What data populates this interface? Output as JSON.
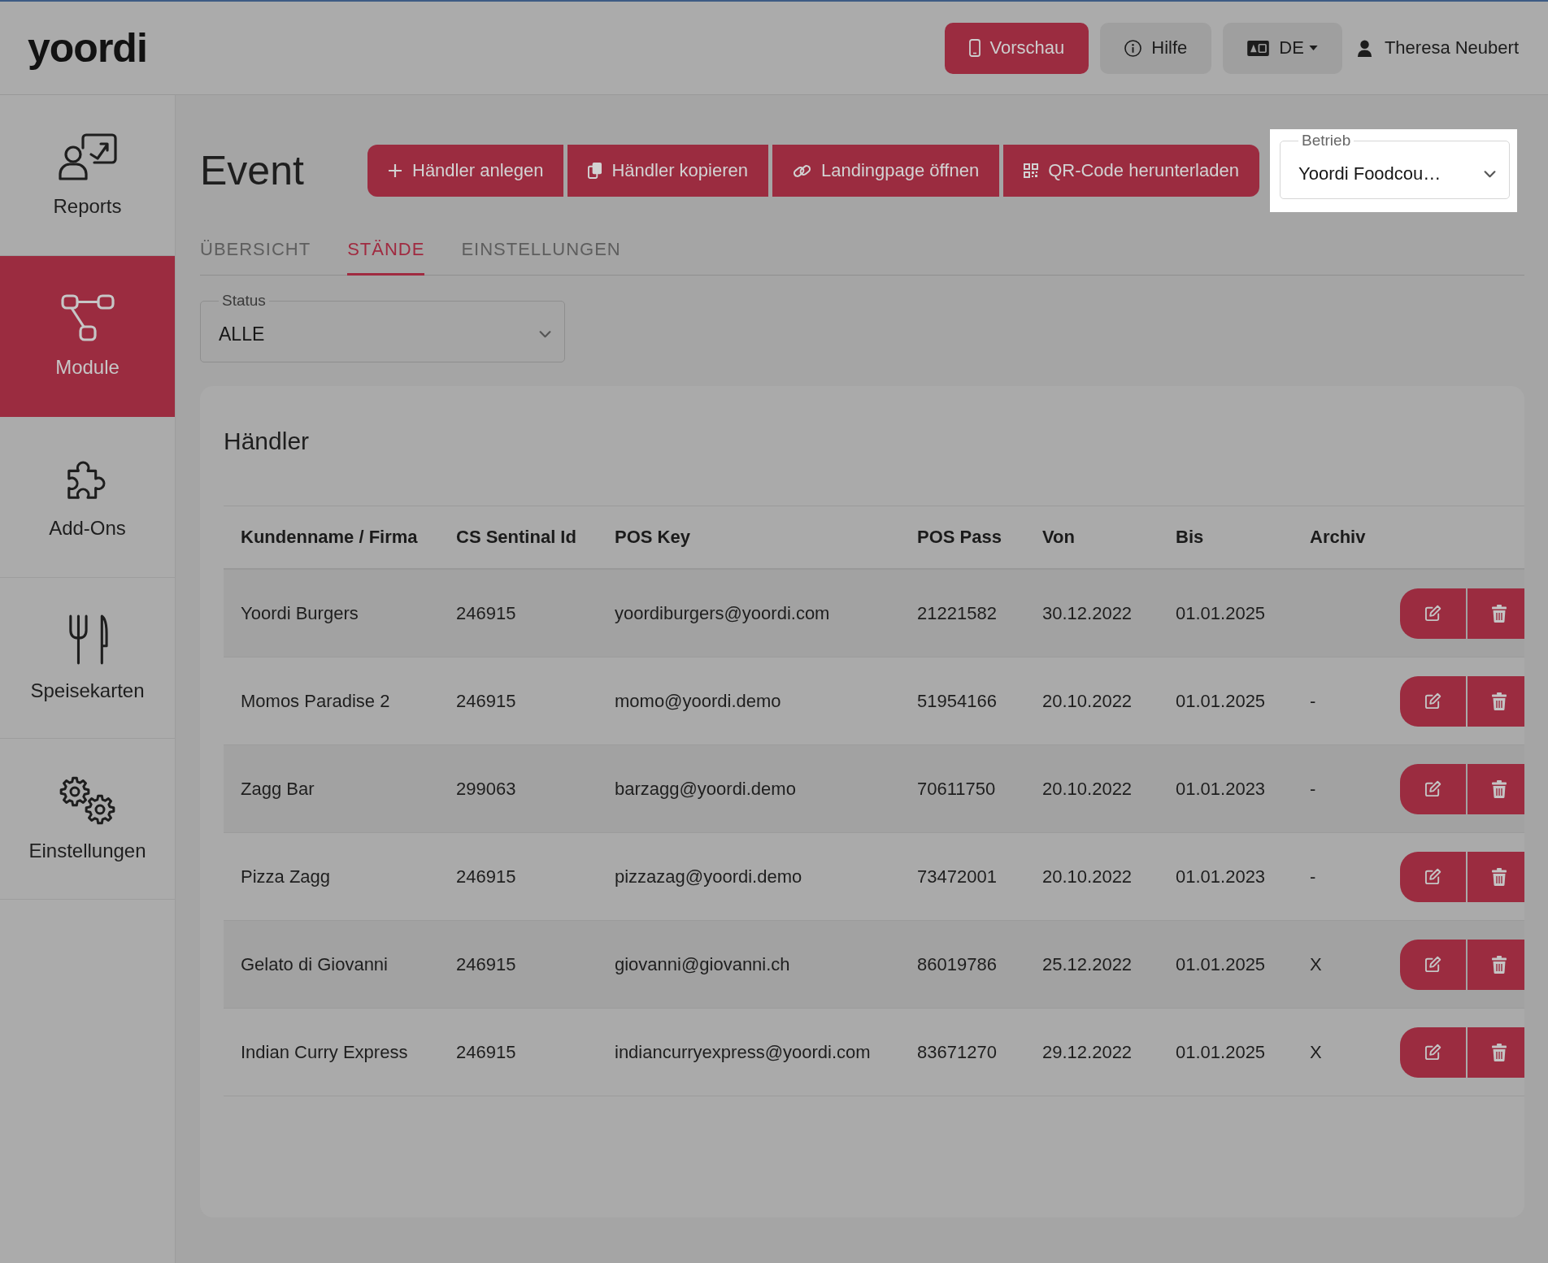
{
  "header": {
    "logo": "yoordi",
    "buttons": [
      {
        "kind": "preview",
        "label": "Vorschau"
      },
      {
        "kind": "help",
        "label": "Hilfe"
      },
      {
        "kind": "language",
        "label": "DE"
      }
    ],
    "user": {
      "name": "Theresa Neubert"
    }
  },
  "sidebar": {
    "items": [
      {
        "kind": "reports",
        "label": "Reports",
        "selected": false
      },
      {
        "kind": "modules",
        "label": "Module",
        "selected": true
      },
      {
        "kind": "addons",
        "label": "Add-Ons",
        "selected": false
      },
      {
        "kind": "menus",
        "label": "Speisekarten",
        "selected": false
      },
      {
        "kind": "settings",
        "label": "Einstellungen",
        "selected": false
      }
    ]
  },
  "page": {
    "title": "Event",
    "actions": [
      {
        "kind": "add",
        "label": "Händler anlegen"
      },
      {
        "kind": "copy",
        "label": "Händler kopieren"
      },
      {
        "kind": "link",
        "label": "Landingpage öffnen"
      },
      {
        "kind": "qr",
        "label": "QR-Code herunterladen"
      }
    ],
    "business_select": {
      "label": "Betrieb",
      "value": "Yoordi Foodcou…",
      "highlighted": true
    }
  },
  "tabs": [
    {
      "label": "ÜBERSICHT",
      "selected": false
    },
    {
      "label": "STÄNDE",
      "selected": true
    },
    {
      "label": "EINSTELLUNGEN",
      "selected": false
    }
  ],
  "status_filter": {
    "label": "Status",
    "value": "ALLE"
  },
  "merchants": {
    "title": "Händler",
    "columns": [
      "Kundenname / Firma",
      "CS Sentinal Id",
      "POS Key",
      "POS Pass",
      "Von",
      "Bis",
      "Archiv"
    ],
    "rows": [
      {
        "cells": [
          "Yoordi Burgers",
          "246915",
          "yoordiburgers@yoordi.com",
          "21221582",
          "30.12.2022",
          "01.01.2025"
        ]
      },
      {
        "cells": [
          "Momos Paradise 2",
          "246915",
          "momo@yoordi.demo",
          "51954166",
          "20.10.2022",
          "01.01.2025",
          "-"
        ]
      },
      {
        "cells": [
          "Zagg Bar",
          "299063",
          "barzagg@yoordi.demo",
          "70611750",
          "20.10.2022",
          "01.01.2023",
          "-"
        ]
      },
      {
        "cells": [
          "Pizza Zagg",
          "246915",
          "pizzazag@yoordi.demo",
          "73472001",
          "20.10.2022",
          "01.01.2023",
          "-"
        ]
      },
      {
        "cells": [
          "Gelato di Giovanni",
          "246915",
          "giovanni@giovanni.ch",
          "86019786",
          "25.12.2022",
          "01.01.2025",
          "X"
        ]
      },
      {
        "cells": [
          "Indian Curry Express",
          "246915",
          "indiancurryexpress@yoordi.com",
          "83671270",
          "29.12.2022",
          "01.01.2025",
          "X"
        ]
      }
    ]
  }
}
